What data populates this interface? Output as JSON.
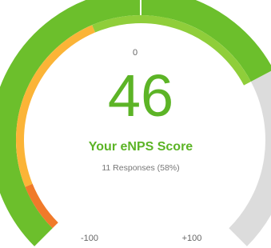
{
  "gauge": {
    "score": "46",
    "score_numeric": 46,
    "min_label": "-100",
    "max_label": "+100",
    "zero_label": "0",
    "range_min": -100,
    "range_max": 100,
    "title": "Your eNPS Score",
    "subtitle": "11 Responses (58%)",
    "segments": [
      {
        "name": "detractor-band",
        "color": "#f07a2a",
        "from": -100,
        "to": -83
      },
      {
        "name": "passive-band",
        "color": "#fbb437",
        "from": -83,
        "to": -17
      },
      {
        "name": "promoter-band",
        "color": "#8fce3a",
        "from": -17,
        "to": 46
      }
    ]
  },
  "colors": {
    "score_green": "#5cb426",
    "arc_green": "#6cbf2c",
    "arc_remaining": "#dcdcdc",
    "text_grey": "#666666"
  }
}
